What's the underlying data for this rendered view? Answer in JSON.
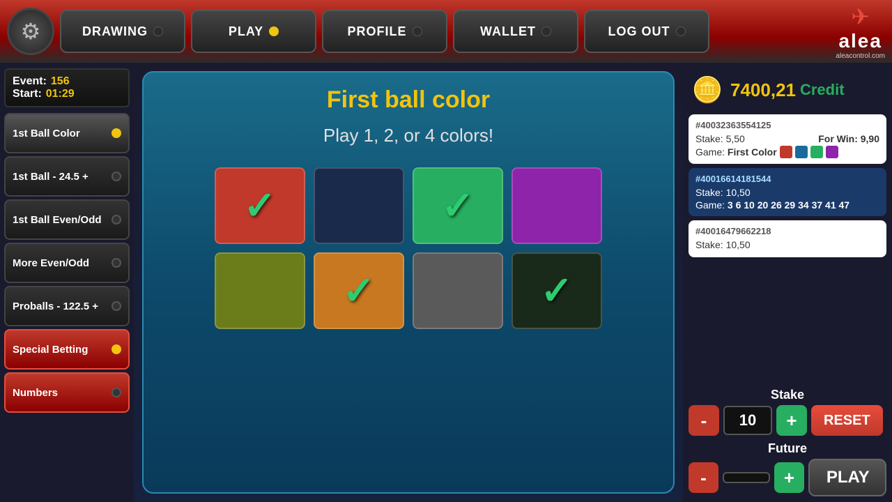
{
  "header": {
    "nav_items": [
      {
        "id": "drawing",
        "label": "DRAWING",
        "dot": "dark"
      },
      {
        "id": "play",
        "label": "PLAY",
        "dot": "yellow"
      },
      {
        "id": "profile",
        "label": "PROFILE",
        "dot": "dark"
      },
      {
        "id": "wallet",
        "label": "WALLET",
        "dot": "dark"
      },
      {
        "id": "logout",
        "label": "LOG OUT",
        "dot": "dark"
      }
    ],
    "logo": {
      "brand": "alea",
      "sub": "aleacontrol.com"
    }
  },
  "sidebar": {
    "event_label": "Event:",
    "event_value": "156",
    "start_label": "Start:",
    "start_value": "01:29",
    "items": [
      {
        "id": "1st-ball-color",
        "label": "1st Ball Color",
        "dot": "yellow",
        "active": true
      },
      {
        "id": "1st-ball-245",
        "label": "1st Ball - 24.5 +",
        "dot": "dark",
        "active": false
      },
      {
        "id": "1st-ball-evenodd",
        "label": "1st Ball Even/Odd",
        "dot": "dark",
        "active": false
      },
      {
        "id": "more-evenodd",
        "label": "More Even/Odd",
        "dot": "dark",
        "active": false
      },
      {
        "id": "proballs",
        "label": "Proballs - 122.5 +",
        "dot": "dark",
        "active": false
      },
      {
        "id": "special-betting",
        "label": "Special Betting",
        "dot": "yellow",
        "special": true
      },
      {
        "id": "numbers",
        "label": "Numbers",
        "dot": "dark",
        "numbers": true
      }
    ]
  },
  "game": {
    "title": "First ball color",
    "subtitle": "Play 1, 2, or 4 colors!",
    "colors": [
      {
        "id": "red",
        "css_class": "color-red",
        "selected": true
      },
      {
        "id": "blue",
        "css_class": "color-blue",
        "selected": false
      },
      {
        "id": "green",
        "css_class": "color-green",
        "selected": true
      },
      {
        "id": "purple",
        "css_class": "color-purple",
        "selected": false
      },
      {
        "id": "olive",
        "css_class": "color-olive",
        "selected": false
      },
      {
        "id": "orange",
        "css_class": "color-orange",
        "selected": true
      },
      {
        "id": "gray",
        "css_class": "color-gray",
        "selected": false
      },
      {
        "id": "darkblue",
        "css_class": "color-darkblue",
        "selected": true
      }
    ]
  },
  "right_panel": {
    "credit_amount": "7400,21",
    "credit_label": "Credit",
    "bets": [
      {
        "id": "#40032363554125",
        "stake_label": "Stake:",
        "stake_value": "5,50",
        "win_label": "For Win:",
        "win_value": "9,90",
        "game_label": "Game:",
        "game_value": "First Color",
        "color_swatches": [
          "#c0392b",
          "#1a6b9a",
          "#27ae60",
          "#8e24aa"
        ],
        "selected": false
      },
      {
        "id": "#40016614181544",
        "stake_label": "Stake:",
        "stake_value": "10,50",
        "win_label": "",
        "win_value": "",
        "game_label": "Game:",
        "game_value": "3 6 10 20 26 29 34 37 41 47",
        "color_swatches": [],
        "selected": true
      },
      {
        "id": "#40016479662218",
        "stake_label": "Stake:",
        "stake_value": "10,50",
        "win_label": "",
        "win_value": "",
        "game_label": "",
        "game_value": "",
        "color_swatches": [],
        "selected": false
      }
    ],
    "stake": {
      "label": "Stake",
      "value": "10",
      "minus_label": "-",
      "plus_label": "+",
      "reset_label": "RESET"
    },
    "future": {
      "label": "Future",
      "value": "",
      "minus_label": "-",
      "plus_label": "+",
      "play_label": "PLAY"
    }
  }
}
